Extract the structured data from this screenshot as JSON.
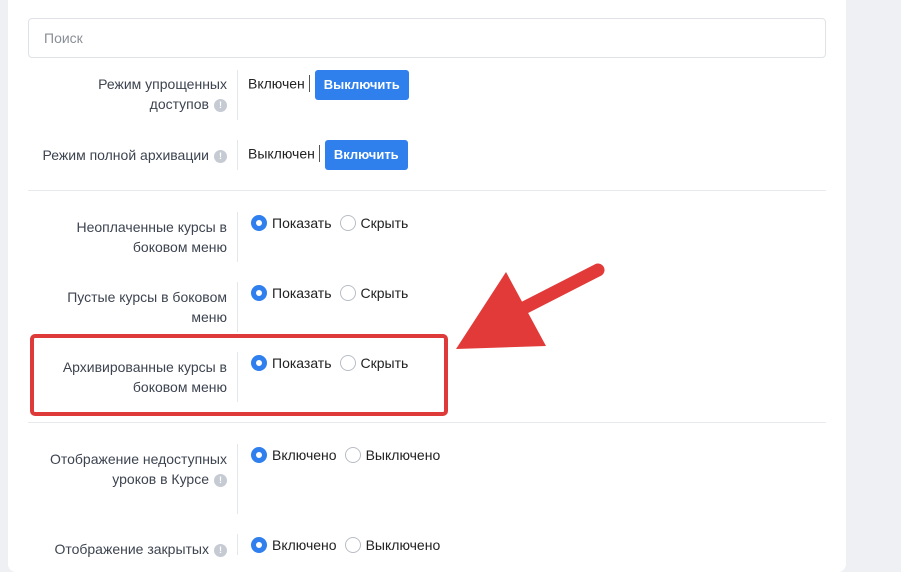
{
  "search": {
    "placeholder": "Поиск"
  },
  "access_rows": [
    {
      "label": "Режим упрощенных доступов",
      "status": "Включен",
      "button": "Выключить"
    },
    {
      "label": "Режим полной архивации",
      "status": "Выключен",
      "button": "Включить"
    }
  ],
  "sidebar_rows": [
    {
      "label": "Неоплаченные курсы в боковом меню",
      "options": [
        "Показать",
        "Скрыть"
      ],
      "selected": "Показать"
    },
    {
      "label": "Пустые курсы в боковом меню",
      "options": [
        "Показать",
        "Скрыть"
      ],
      "selected": "Показать"
    },
    {
      "label": "Архивированные курсы в боковом меню",
      "options": [
        "Показать",
        "Скрыть"
      ],
      "selected": "Показать"
    }
  ],
  "lesson_rows": [
    {
      "label": "Отображение недоступных уроков в Курсе",
      "options": [
        "Включено",
        "Выключено"
      ],
      "selected": "Включено"
    },
    {
      "label": "Отображение закрытых",
      "options": [
        "Включено",
        "Выключено"
      ],
      "selected": "Включено"
    }
  ],
  "colors": {
    "accent": "#2f80ed",
    "annotation": "#df3a3a"
  },
  "icons": {
    "info": "info-icon",
    "annotation_arrow": "arrow-annotation"
  }
}
